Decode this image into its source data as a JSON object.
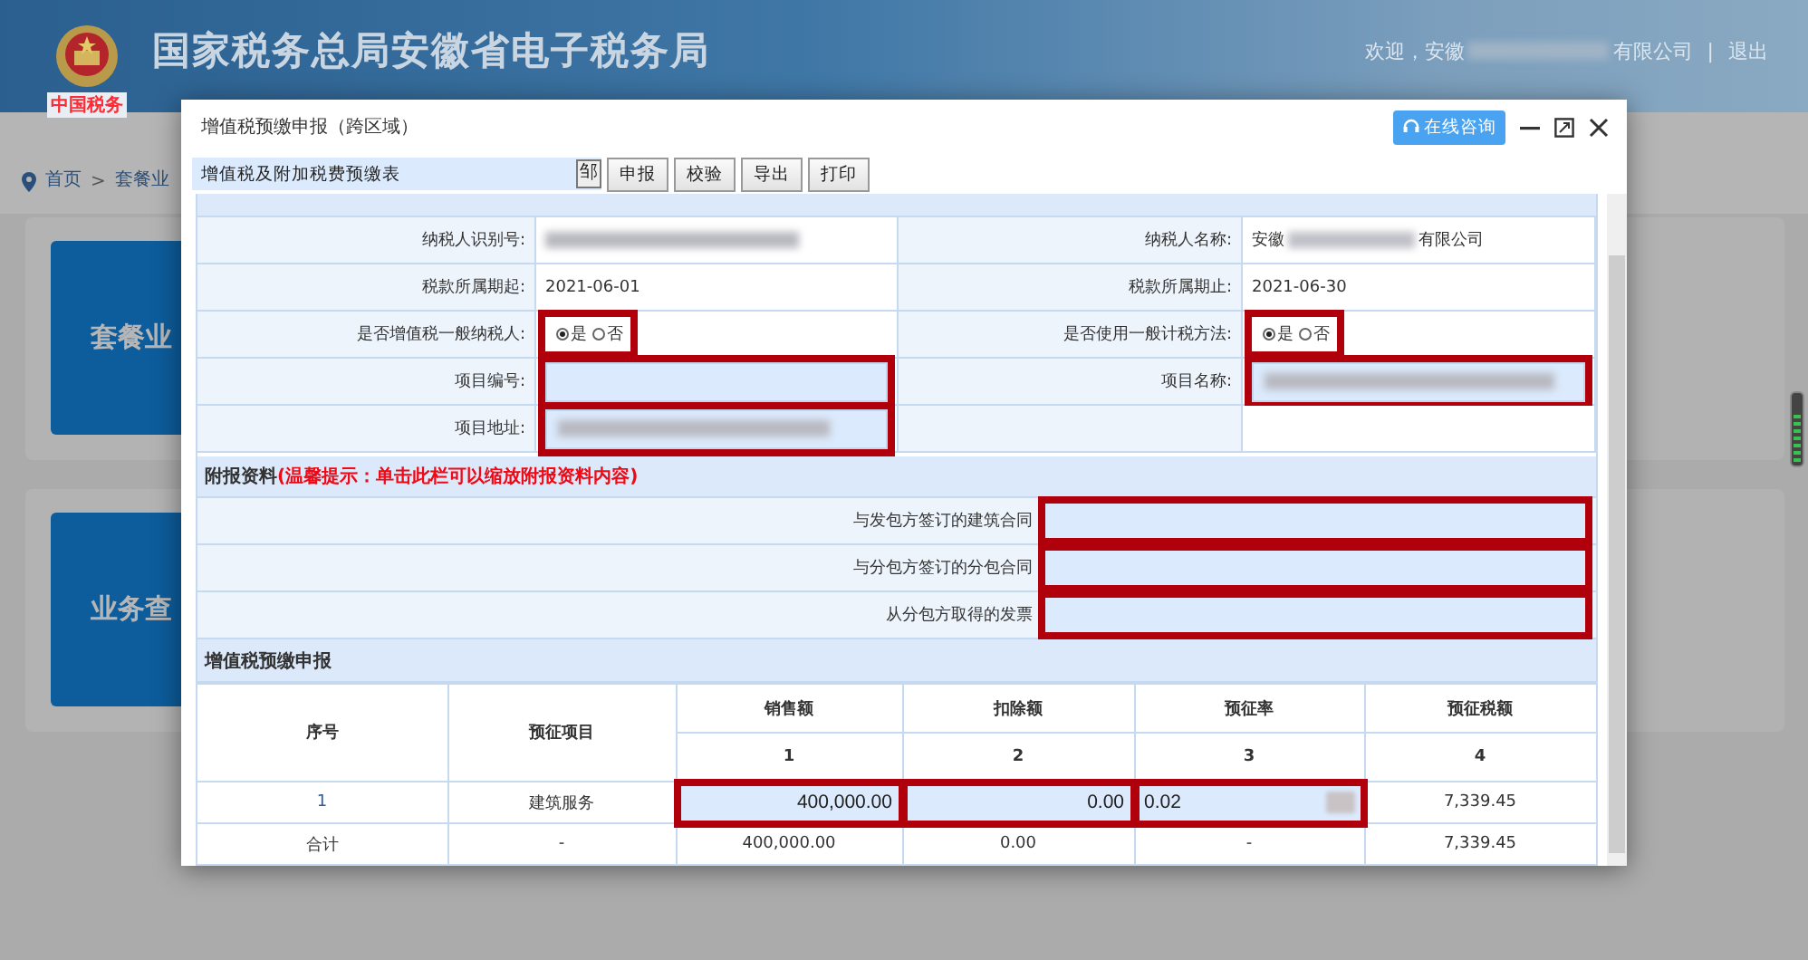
{
  "header": {
    "title": "国家税务总局安徽省电子税务局",
    "logo_caption": "中国税务",
    "greeting": "欢迎，安徽",
    "company_suffix": "有限公司",
    "separator": "|",
    "logout": "退出"
  },
  "breadcrumb": {
    "separator": ">",
    "items": [
      {
        "label": "首页"
      },
      {
        "label": "套餐业"
      }
    ]
  },
  "cards": [
    {
      "label": "套餐业"
    },
    {
      "label": "业务查"
    }
  ],
  "dialog": {
    "title": "增值税预缴申报（跨区域）",
    "consult_button": "在线咨询",
    "toolbar": {
      "form_select": "增值税及附加税费预缴表",
      "select_glyph": "邹",
      "buttons": [
        "申报",
        "校验",
        "导出",
        "打印"
      ]
    },
    "info": {
      "rows": [
        {
          "cells": [
            {
              "kind": "label",
              "text": "纳税人识别号:"
            },
            {
              "kind": "blurred"
            },
            {
              "kind": "label",
              "text": "纳税人名称:"
            },
            {
              "kind": "partial",
              "prefix": "安徽",
              "suffix": "有限公司"
            }
          ]
        },
        {
          "cells": [
            {
              "kind": "label",
              "text": "税款所属期起:"
            },
            {
              "kind": "text",
              "text": "2021-06-01"
            },
            {
              "kind": "label",
              "text": "税款所属期止:"
            },
            {
              "kind": "text",
              "text": "2021-06-30"
            }
          ]
        },
        {
          "cells": [
            {
              "kind": "label",
              "text": "是否增值税一般纳税人:"
            },
            {
              "kind": "radio",
              "highlighted": true,
              "options": [
                {
                  "label": "是",
                  "selected": true
                },
                {
                  "label": "否",
                  "selected": false
                }
              ]
            },
            {
              "kind": "label",
              "text": "是否使用一般计税方法:"
            },
            {
              "kind": "radio",
              "highlighted": true,
              "options": [
                {
                  "label": "是",
                  "selected": true
                },
                {
                  "label": "否",
                  "selected": false
                }
              ]
            }
          ]
        },
        {
          "cells": [
            {
              "kind": "label",
              "text": "项目编号:"
            },
            {
              "kind": "input",
              "blurred": false,
              "highlighted": true
            },
            {
              "kind": "label",
              "text": "项目名称:"
            },
            {
              "kind": "input",
              "blurred": true,
              "highlighted": true
            }
          ]
        },
        {
          "cells": [
            {
              "kind": "label",
              "text": "项目地址:"
            },
            {
              "kind": "input",
              "blurred": true,
              "highlighted": true
            }
          ]
        }
      ]
    },
    "attachments": {
      "title": "附报资料",
      "hint": "(温馨提示：单击此栏可以缩放附报资料内容)",
      "items": [
        {
          "label": "与发包方签订的建筑合同",
          "highlighted": true
        },
        {
          "label": "与分包方签订的分包合同",
          "highlighted": true
        },
        {
          "label": "从分包方取得的发票",
          "highlighted": true
        }
      ]
    },
    "declaration": {
      "title": "增值税预缴申报",
      "columns": [
        {
          "label": "序号"
        },
        {
          "label": "预征项目"
        },
        {
          "label": "销售额",
          "number": "1"
        },
        {
          "label": "扣除额",
          "number": "2"
        },
        {
          "label": "预征率",
          "number": "3"
        },
        {
          "label": "预征税额",
          "number": "4"
        }
      ],
      "rows": [
        {
          "cells": [
            {
              "kind": "link",
              "text": "1"
            },
            {
              "kind": "text",
              "text": "建筑服务"
            },
            {
              "kind": "amount_input",
              "value": "400,000.00",
              "highlighted": true
            },
            {
              "kind": "amount_input",
              "value": "0.00",
              "highlighted": true
            },
            {
              "kind": "rate_input",
              "value": "0.02",
              "highlighted": true
            },
            {
              "kind": "text",
              "text": "7,339.45"
            }
          ]
        },
        {
          "cells": [
            {
              "kind": "text",
              "text": "合计"
            },
            {
              "kind": "text",
              "text": "-"
            },
            {
              "kind": "text",
              "text": "400,000.00"
            },
            {
              "kind": "text",
              "text": "0.00"
            },
            {
              "kind": "text",
              "text": "-"
            },
            {
              "kind": "text",
              "text": "7,339.45"
            }
          ]
        }
      ]
    }
  }
}
